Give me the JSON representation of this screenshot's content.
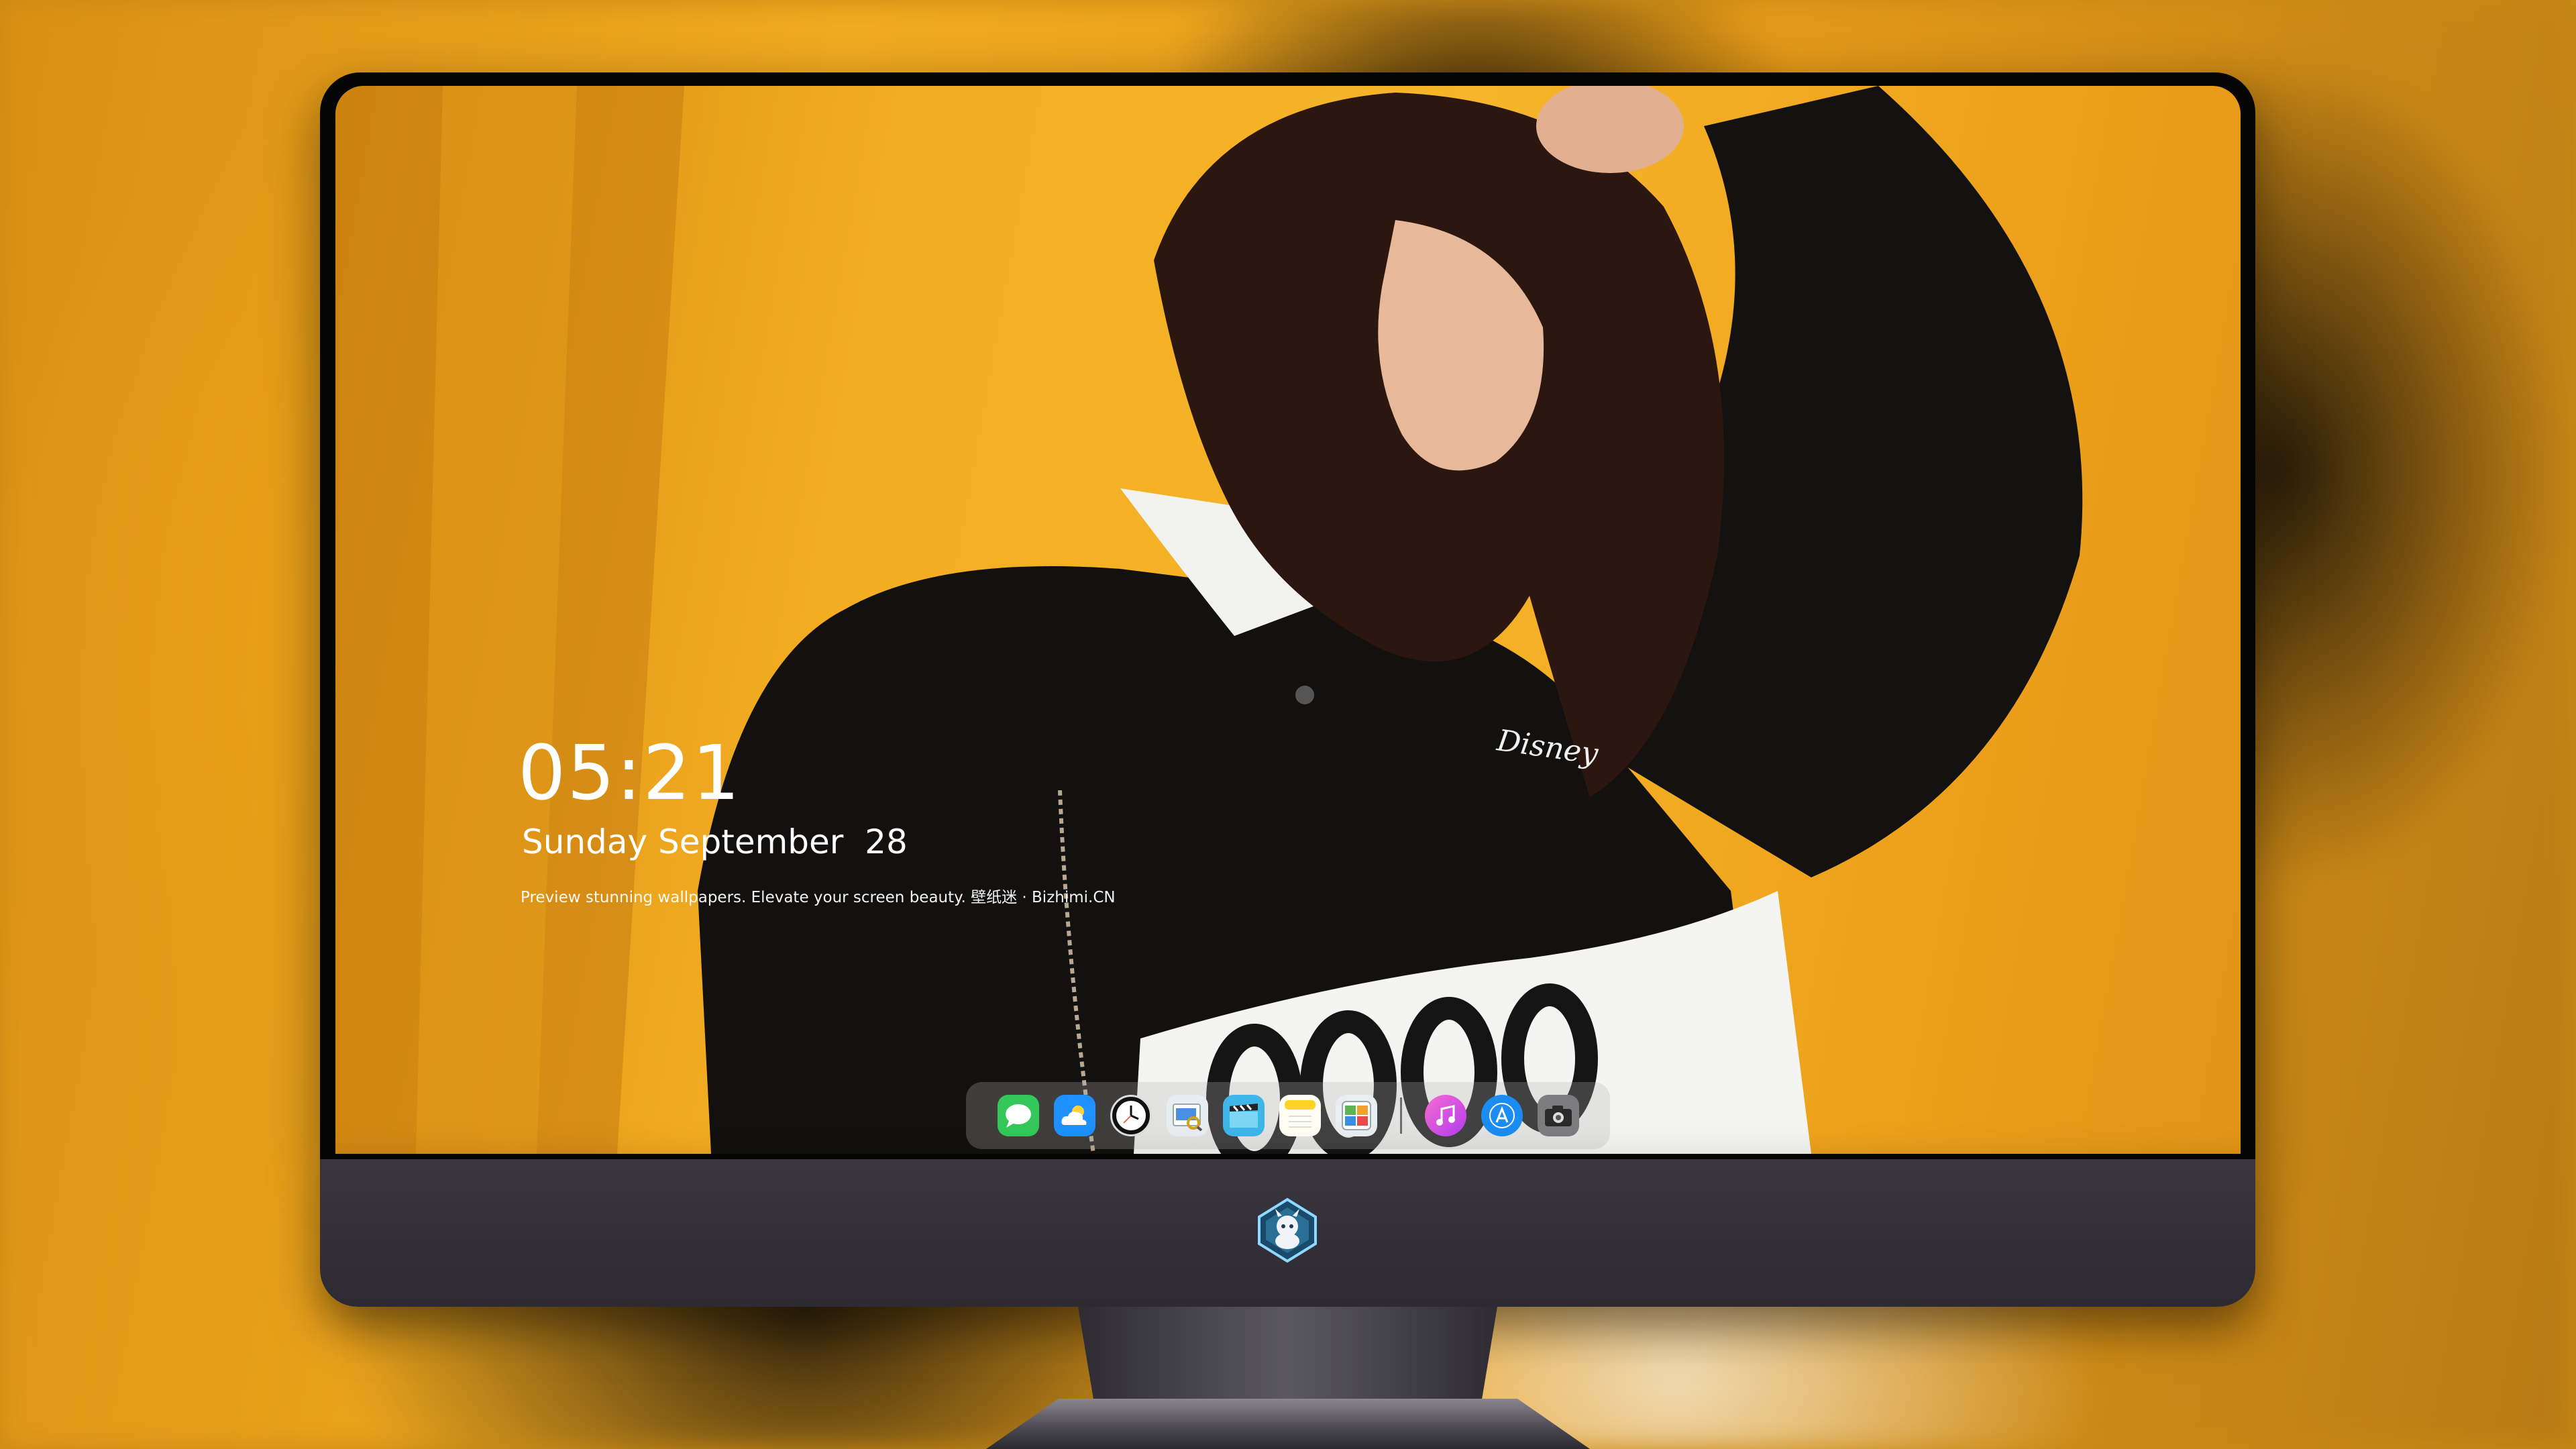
{
  "lockscreen": {
    "time": "05:21",
    "date": "Sunday September  28",
    "tagline": "Preview stunning wallpapers. Elevate your screen beauty. 壁纸迷 · Bizhimi.CN"
  },
  "wallpaper": {
    "shirt_logo": "Disney",
    "background_color": "#f0aa20"
  },
  "dock": {
    "apps": [
      {
        "name": "messages-icon",
        "color": "#34c759"
      },
      {
        "name": "weather-icon",
        "color": "#1e90ff"
      },
      {
        "name": "clock-icon",
        "color": "#111111"
      },
      {
        "name": "preview-icon",
        "color": "#4a90e2"
      },
      {
        "name": "video-icon",
        "color": "#3fb6e8"
      },
      {
        "name": "notes-icon",
        "color": "#ffd426"
      },
      {
        "name": "photo-app-icon",
        "color": "#5ab552"
      },
      {
        "name": "music-icon",
        "color": "#e23fb0"
      },
      {
        "name": "app-store-icon",
        "color": "#1b8cf2"
      },
      {
        "name": "camera-icon",
        "color": "#8a8a8a"
      }
    ]
  },
  "monitor": {
    "chin_color": "#2d2a33"
  }
}
